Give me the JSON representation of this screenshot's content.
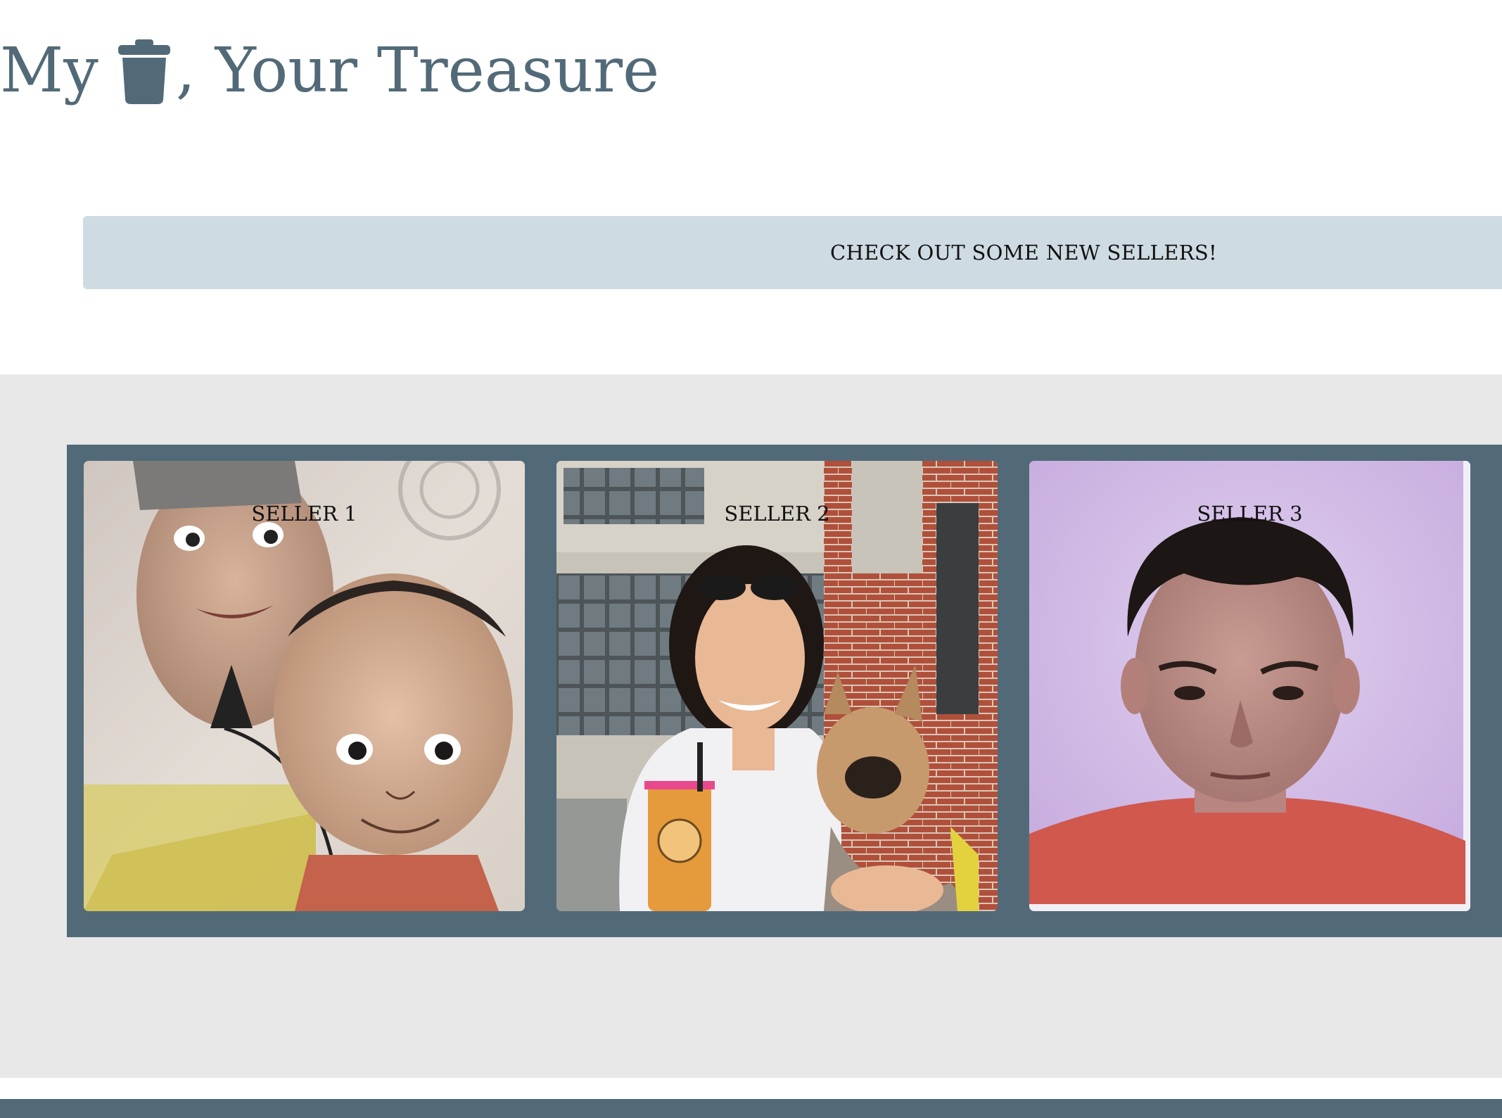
{
  "header": {
    "title_prefix": "My",
    "title_icon": "trash-icon",
    "title_suffix": ", Your Treasure"
  },
  "banner": {
    "text": "CHECK OUT SOME NEW SELLERS!"
  },
  "sellers": [
    {
      "label": "SELLER 1",
      "image": "caricature-portrait"
    },
    {
      "label": "SELLER 2",
      "image": "woman-with-french-bulldog-photo"
    },
    {
      "label": "SELLER 3",
      "image": "man-portrait-photo"
    }
  ],
  "colors": {
    "brand": "#526a78",
    "banner_bg": "#cfdbe2",
    "band_bg": "#e8e8e8"
  }
}
